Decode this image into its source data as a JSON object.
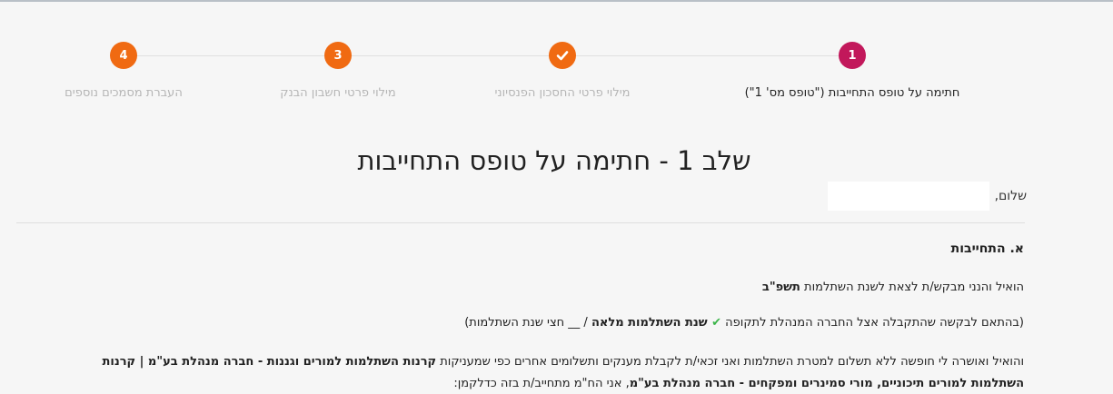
{
  "colors": {
    "active_step": "#c2185b",
    "done_step": "#f06a12",
    "pending_step": "#f06a12",
    "check_green": "#3cb54a"
  },
  "stepper": {
    "steps": [
      {
        "number": "1",
        "label": "חתימה על טופס התחייבות (\"טופס מס' 1\")",
        "state": "active"
      },
      {
        "number": "",
        "label": "מילוי פרטי החסכון הפנסיוני",
        "state": "done",
        "icon": "check-icon"
      },
      {
        "number": "3",
        "label": "מילוי פרטי חשבון הבנק",
        "state": "pending"
      },
      {
        "number": "4",
        "label": "העברת מסמכים נוספים",
        "state": "pending"
      }
    ]
  },
  "page": {
    "title": "שלב 1 - חתימה על טופס התחייבות",
    "greeting": "שלום,"
  },
  "section": {
    "title": "א. התחייבות",
    "line1_text": "הואיל והנני מבקש/ת לצאת לשנת השתלמות ",
    "line1_bold": "תשפ\"ב",
    "line2_prefix": "(בהתאם לבקשה שהתקבלה אצל החברה המנהלת לתקופה ",
    "line2_checkmark": "✔",
    "line2_bold": " שנת השתלמות מלאה",
    "line2_suffix": " / __ חצי שנת השתלמות)",
    "para3_text": "והואיל ואושרה לי חופשה ללא תשלום למטרת השתלמות ואני זכאי/ת לקבלת מענקים ותשלומים אחרים כפי שמעניקות ",
    "para3_bold1": "קרנות השתלמות למורים וגננות - חברה מנהלת בע\"מ | קרנות השתלמות למורים תיכוניים, מורי סמינרים ומפקחים - חברה מנהלת בע\"מ",
    "para3_suffix": ", אני הח\"מ מתחייב/ת בזה כדלקמן:"
  }
}
